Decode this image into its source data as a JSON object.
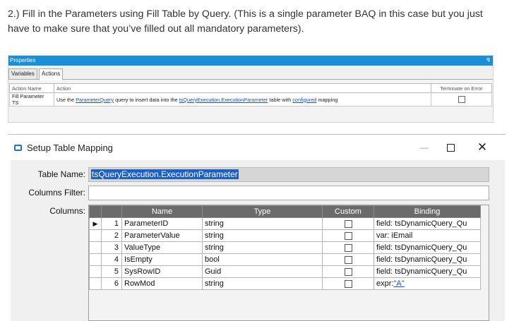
{
  "intro_text": "2.) Fill in the Parameters using Fill Table by Query. (This is a single parameter BAQ in this case but you just have to make sure that you’ve filled out all mandatory parameters).",
  "properties_panel": {
    "title": "Properties",
    "pin_icon": "pin-icon",
    "tabs": [
      {
        "label": "Variables",
        "active": false
      },
      {
        "label": "Actions",
        "active": true
      }
    ],
    "columns": [
      "Action Name",
      "Action",
      "Terminate on Error"
    ],
    "row": {
      "action_name": "Fill Parameter TS",
      "action_pre": "Use the",
      "action_link1": "ParameterQuery",
      "action_mid1": "query to insert data into the",
      "action_link2": "tsQueryExecution.ExecutionParameter",
      "action_mid2": "table with",
      "action_link3": "configured",
      "action_post": "mapping",
      "terminate_on_error": false
    }
  },
  "dialog": {
    "title": "Setup Table Mapping",
    "minimize_label": "—",
    "close_label": "✕",
    "table_name_label": "Table Name:",
    "table_name_value": "tsQueryExecution.ExecutionParameter",
    "columns_filter_label": "Columns Filter:",
    "columns_filter_value": "",
    "columns_label": "Columns:",
    "grid": {
      "headers": [
        "Name",
        "Type",
        "Custom",
        "Binding"
      ],
      "selector_glyph": "▶",
      "rows": [
        {
          "num": "1",
          "name": "ParameterID",
          "type": "string",
          "custom": false,
          "binding": "field: tsDynamicQuery_Qu",
          "selected": true
        },
        {
          "num": "2",
          "name": "ParameterValue",
          "type": "string",
          "custom": false,
          "binding": "var: iEmail",
          "selected": false
        },
        {
          "num": "3",
          "name": "ValueType",
          "type": "string",
          "custom": false,
          "binding": "field: tsDynamicQuery_Qu",
          "selected": false
        },
        {
          "num": "4",
          "name": "IsEmpty",
          "type": "bool",
          "custom": false,
          "binding": "field: tsDynamicQuery_Qu",
          "selected": false
        },
        {
          "num": "5",
          "name": "SysRowID",
          "type": "Guid",
          "custom": false,
          "binding": "field: tsDynamicQuery_Qu",
          "selected": false
        },
        {
          "num": "6",
          "name": "RowMod",
          "type": "string",
          "custom": false,
          "binding_prefix": "expr:",
          "binding_link": "\"A\"",
          "selected": false
        }
      ]
    }
  }
}
